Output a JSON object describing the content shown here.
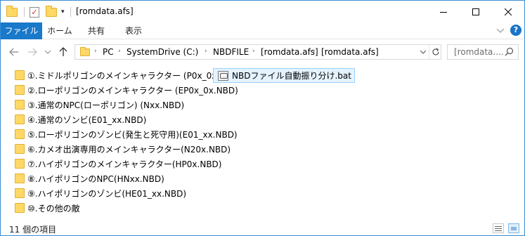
{
  "window": {
    "title": "[romdata.afs]"
  },
  "ribbon": {
    "tabs": [
      "ファイル",
      "ホーム",
      "共有",
      "表示"
    ]
  },
  "address": {
    "crumbs": [
      "PC",
      "SystemDrive (C:)",
      "NBDFILE",
      "[romdata.afs]",
      "[romdata.afs]"
    ]
  },
  "search": {
    "placeholder": "[romdata...."
  },
  "folders": [
    "①.ミドルポリゴンのメインキャラクター (P0x_0x.NBD)",
    "②.ローポリゴンのメインキャラクター (EP0x_0x.NBD)",
    "③.通常のNPC(ローポリゴン) (Nxx.NBD)",
    "④.通常のゾンビ(E01_xx.NBD)",
    "⑤.ローポリゴンのゾンビ(発生と死守用)(E01_xx.NBD)",
    "⑥.カメオ出演専用のメインキャラクター(N20x.NBD)",
    "⑦.ハイポリゴンのメインキャラクター(HP0x.NBD)",
    "⑧.ハイポリゴンのNPC(HNxx.NBD)",
    "⑨.ハイポリゴンのゾンビ(HE01_xx.NBD)",
    "⑩.その他の敵"
  ],
  "file": {
    "name": "NBDファイル自動振り分け.bat"
  },
  "status": {
    "count": "11 個の項目"
  },
  "colors": {
    "accent": "#1979ca",
    "folder": "#ffd866",
    "selection": "#e5f3ff"
  }
}
